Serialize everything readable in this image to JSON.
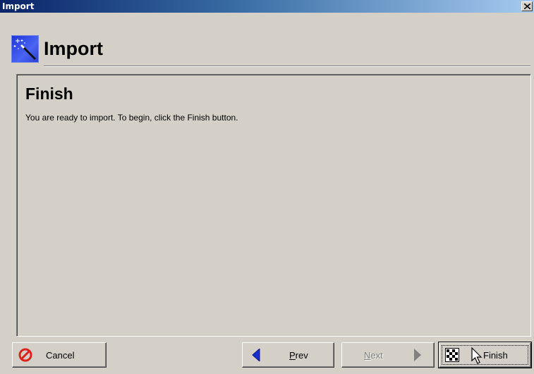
{
  "window": {
    "title": "Import",
    "close_symbol": "×"
  },
  "header": {
    "title": "Import",
    "icon": "wizard-wand-icon"
  },
  "step": {
    "title": "Finish",
    "description": "You are ready to import.  To begin, click the Finish button."
  },
  "buttons": {
    "cancel": {
      "label": "Cancel",
      "icon": "cancel-icon",
      "enabled": true
    },
    "prev": {
      "label_first": "P",
      "label_rest": "rev",
      "icon": "arrow-left-icon",
      "enabled": true
    },
    "next": {
      "label_first": "N",
      "label_rest": "ext",
      "icon": "arrow-right-icon",
      "enabled": false
    },
    "finish": {
      "label": "Finish",
      "icon": "checkered-flag-icon",
      "enabled": true,
      "focused": true
    }
  },
  "colors": {
    "titlebar_start": "#0a246a",
    "titlebar_end": "#a6caf0",
    "face": "#d4d0c8",
    "prev_arrow": "#1a2fd0",
    "cancel_red": "#e0201c"
  }
}
